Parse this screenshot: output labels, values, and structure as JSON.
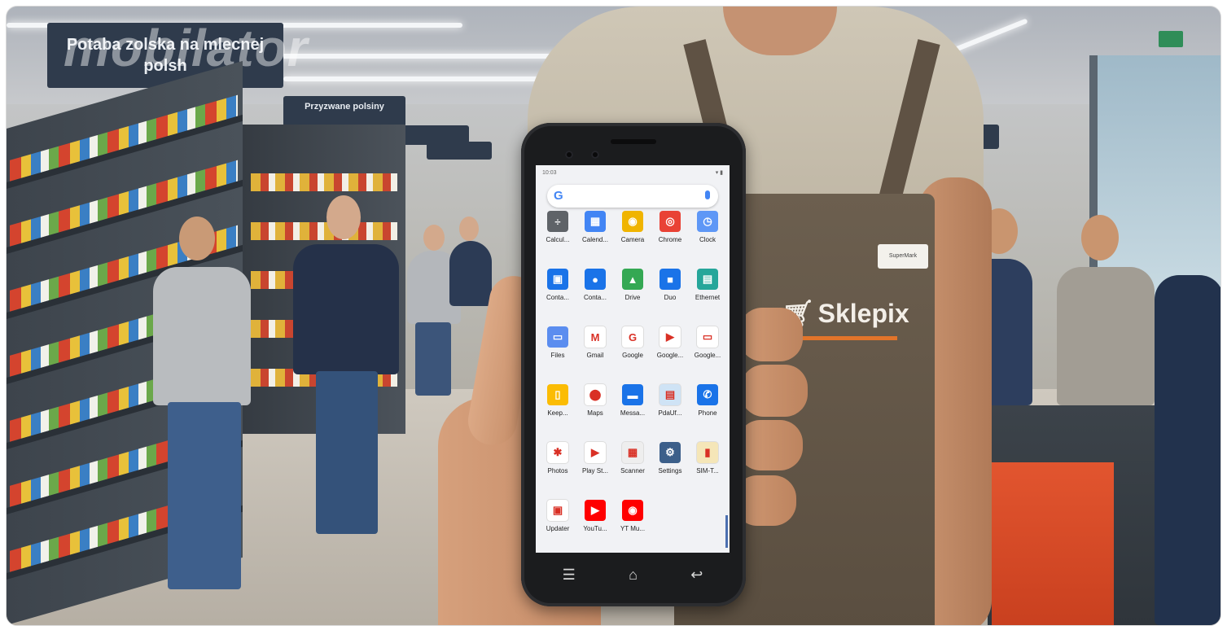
{
  "watermark": "mobilator",
  "store_signs": {
    "sign1": "Potaba zolska na mlecnej polsh",
    "sign2": "Przyzwane polsiny",
    "sign3": "",
    "sign4": "",
    "sign5": ""
  },
  "apron": {
    "logo_text": "Sklepix",
    "cart_icon": "cart-icon",
    "nametag": "SuperMark"
  },
  "phone": {
    "status_time": "10:03",
    "status_right": "▾ ▮",
    "search_logo": "G",
    "apps": [
      {
        "label": "Calcul...",
        "icon": "calculator-icon",
        "color": "#5f6368",
        "glyph": "÷"
      },
      {
        "label": "Calend...",
        "icon": "calendar-icon",
        "color": "#4285f4",
        "glyph": "▦"
      },
      {
        "label": "Camera",
        "icon": "camera-icon",
        "color": "#f0b400",
        "glyph": "◉"
      },
      {
        "label": "Chrome",
        "icon": "chrome-icon",
        "color": "#e94235",
        "glyph": "◎"
      },
      {
        "label": "Clock",
        "icon": "clock-icon",
        "color": "#5e97f6",
        "glyph": "◷"
      },
      {
        "label": "Conta...",
        "icon": "contacts-icon",
        "color": "#1a73e8",
        "glyph": "▣"
      },
      {
        "label": "Conta...",
        "icon": "contacts-alt-icon",
        "color": "#1a73e8",
        "glyph": "●"
      },
      {
        "label": "Drive",
        "icon": "drive-icon",
        "color": "#34a853",
        "glyph": "▲"
      },
      {
        "label": "Duo",
        "icon": "duo-icon",
        "color": "#1a73e8",
        "glyph": "■"
      },
      {
        "label": "Ethernet",
        "icon": "ethernet-icon",
        "color": "#26a69a",
        "glyph": "▤"
      },
      {
        "label": "Files",
        "icon": "files-icon",
        "color": "#5b8def",
        "glyph": "▭"
      },
      {
        "label": "Gmail",
        "icon": "gmail-icon",
        "color": "#ffffff",
        "glyph": "M"
      },
      {
        "label": "Google",
        "icon": "google-icon",
        "color": "#ffffff",
        "glyph": "G"
      },
      {
        "label": "Google...",
        "icon": "google-play-movies-icon",
        "color": "#ffffff",
        "glyph": "▶"
      },
      {
        "label": "Google...",
        "icon": "google-tv-icon",
        "color": "#ffffff",
        "glyph": "▭"
      },
      {
        "label": "Keep...",
        "icon": "keep-icon",
        "color": "#fbbc04",
        "glyph": "▯"
      },
      {
        "label": "Maps",
        "icon": "maps-icon",
        "color": "#ffffff",
        "glyph": "⬤"
      },
      {
        "label": "Messa...",
        "icon": "messages-icon",
        "color": "#1a73e8",
        "glyph": "▬"
      },
      {
        "label": "PdaUf...",
        "icon": "pdauf-icon",
        "color": "#cfe3f5",
        "glyph": "▤"
      },
      {
        "label": "Phone",
        "icon": "phone-icon",
        "color": "#1a73e8",
        "glyph": "✆"
      },
      {
        "label": "Photos",
        "icon": "photos-icon",
        "color": "#ffffff",
        "glyph": "✱"
      },
      {
        "label": "Play St...",
        "icon": "play-store-icon",
        "color": "#ffffff",
        "glyph": "▶"
      },
      {
        "label": "Scanner",
        "icon": "scanner-icon",
        "color": "#eeeeee",
        "glyph": "▦"
      },
      {
        "label": "Settings",
        "icon": "settings-icon",
        "color": "#3c5f8a",
        "glyph": "⚙"
      },
      {
        "label": "SIM-T...",
        "icon": "sim-toolkit-icon",
        "color": "#f5e6b8",
        "glyph": "▮"
      },
      {
        "label": "Updater",
        "icon": "updater-icon",
        "color": "#ffffff",
        "glyph": "▣"
      },
      {
        "label": "YouTu...",
        "icon": "youtube-icon",
        "color": "#ff0000",
        "glyph": "▶"
      },
      {
        "label": "YT Mu...",
        "icon": "youtube-music-icon",
        "color": "#ff0000",
        "glyph": "◉"
      }
    ],
    "nav": {
      "recents_icon": "☰",
      "home_icon": "⌂",
      "back_icon": "↩"
    }
  }
}
